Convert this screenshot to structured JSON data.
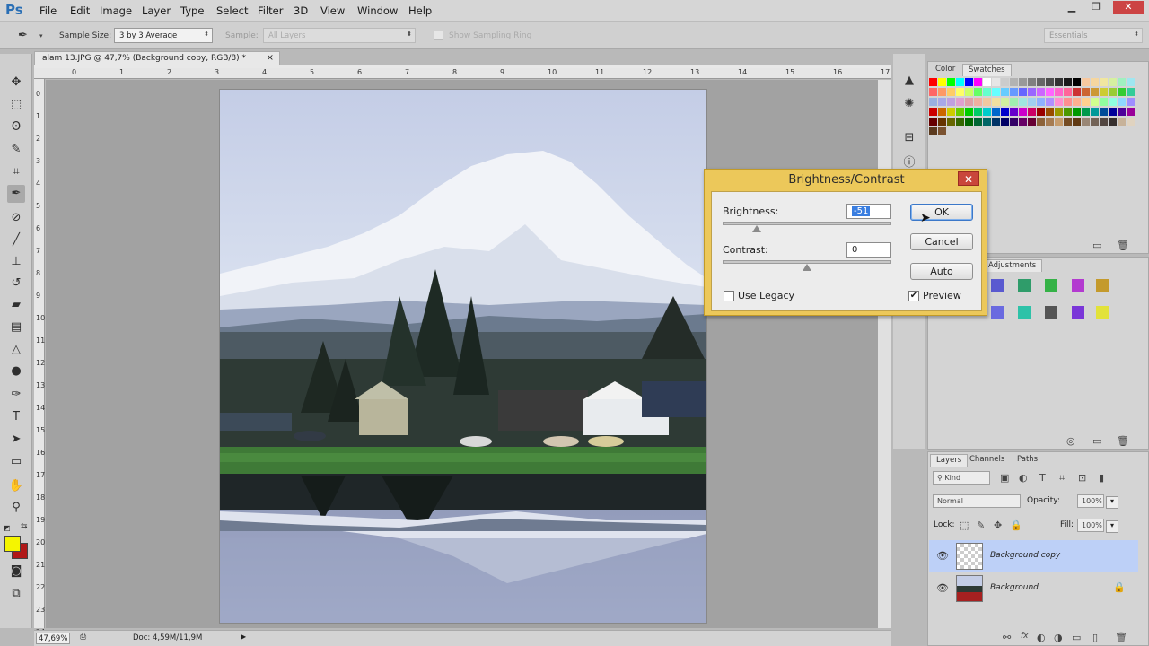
{
  "app": {
    "logo": "Ps"
  },
  "menubar": {
    "items": [
      "File",
      "Edit",
      "Image",
      "Layer",
      "Type",
      "Select",
      "Filter",
      "3D",
      "View",
      "Window",
      "Help"
    ]
  },
  "window_controls": {
    "minimize": "▁",
    "restore": "❐",
    "close": "✕"
  },
  "options": {
    "sample_size_label": "Sample Size:",
    "sample_size_value": "3 by 3 Average",
    "sample_label": "Sample:",
    "sample_value": "All Layers",
    "sampling_ring_label": "Show Sampling Ring",
    "workspace_value": "Essentials"
  },
  "document": {
    "tab_title": "alam 13.JPG @ 47,7% (Background copy, RGB/8) *",
    "tab_close": "×",
    "ruler_h": [
      "0",
      "1",
      "2",
      "3",
      "4",
      "5",
      "6",
      "7",
      "8",
      "9",
      "10",
      "11",
      "12",
      "13",
      "14",
      "15",
      "16",
      "17"
    ],
    "ruler_v": [
      "0",
      "1",
      "2",
      "3",
      "4",
      "5",
      "6",
      "7",
      "8",
      "9",
      "10",
      "11",
      "12",
      "13",
      "14",
      "15",
      "16",
      "17",
      "18",
      "19",
      "20",
      "21",
      "22",
      "23",
      "24"
    ]
  },
  "status": {
    "zoom": "47,69%",
    "doc_info": "Doc: 4,59M/11,9M"
  },
  "colors": {
    "foreground": "#f5f500",
    "background": "#b01818",
    "dialog_frame": "#ecc85a",
    "selected_layer": "#bdd0f7"
  },
  "color_panel": {
    "tabs": [
      "Color",
      "Swatches"
    ],
    "active_tab": "Swatches"
  },
  "adjustments_panel": {
    "tab": "Adjustments"
  },
  "dialog": {
    "title": "Brightness/Contrast",
    "close": "✕",
    "brightness_label": "Brightness:",
    "brightness_value": "-51",
    "contrast_label": "Contrast:",
    "contrast_value": "0",
    "ok_label": "OK",
    "cancel_label": "Cancel",
    "auto_label": "Auto",
    "use_legacy_label": "Use Legacy",
    "use_legacy_checked": false,
    "preview_label": "Preview",
    "preview_checked": true,
    "check_mark": "✔"
  },
  "layers_panel": {
    "tabs": [
      "Layers",
      "Channels",
      "Paths"
    ],
    "active_tab": "Layers",
    "kind_value": "Kind",
    "blend_mode": "Normal",
    "opacity_label": "Opacity:",
    "opacity_value": "100%",
    "lock_label": "Lock:",
    "fill_label": "Fill:",
    "fill_value": "100%",
    "layers": [
      {
        "name": "Background copy",
        "selected": true,
        "visible": true
      },
      {
        "name": "Background",
        "selected": false,
        "visible": true,
        "locked": true
      }
    ],
    "bottom_icons": [
      "fx",
      "◐",
      "◑",
      "▭",
      "▯",
      "🗑"
    ]
  }
}
